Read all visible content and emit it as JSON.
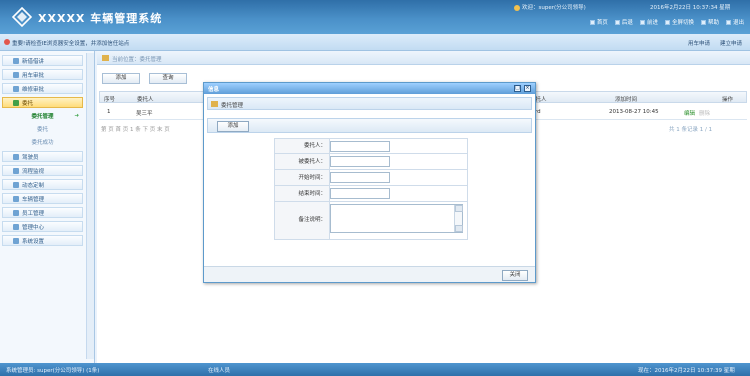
{
  "header": {
    "brand": "XXXXX  车辆管理系统",
    "user": "欢迎：super(分公司领导)",
    "datetime": "2016年2月22日  10:37:34 星期",
    "nav": [
      "首页",
      "后退",
      "前进",
      "全屏切换",
      "帮助",
      "退出"
    ]
  },
  "notice": {
    "text": "重要!请检查IE浏览器安全设置，并添加信任站点",
    "links": [
      "用车申请",
      "建立申请"
    ]
  },
  "sidebar": {
    "items": [
      {
        "label": "新借借讲",
        "icon": "document-icon"
      },
      {
        "label": "用车审批",
        "icon": "car-icon"
      },
      {
        "label": "维修审批",
        "icon": "wrench-icon"
      },
      {
        "label": "委托",
        "icon": "check-icon"
      },
      {
        "label": "驾驶员",
        "icon": "person-icon"
      },
      {
        "label": "流程监视",
        "icon": "chart-icon"
      },
      {
        "label": "动态定制",
        "icon": "grid-icon"
      },
      {
        "label": "车辆管理",
        "icon": "car-icon"
      },
      {
        "label": "员工管理",
        "icon": "people-icon"
      },
      {
        "label": "管理中心",
        "icon": "globe-icon"
      },
      {
        "label": "系统设置",
        "icon": "gear-icon"
      }
    ],
    "sub": [
      "委托管理",
      "委托",
      "委托成功"
    ]
  },
  "main": {
    "crumb": "当前位置：委托管理",
    "buttons": [
      "添加",
      "查询"
    ],
    "columns": [
      "序号",
      "委托人",
      "受托人",
      "开始时间",
      "添加时间",
      "操作"
    ],
    "rows": [
      {
        "no": "1",
        "name": "吴三平",
        "trustee": "rd",
        "added": "2013-08-27 10:45",
        "edit": "编辑",
        "delete": "删除"
      }
    ],
    "pager": "第 页 首 页 1 条 下 页 末 页",
    "pager_right": "共 1 条记录    1 / 1"
  },
  "dialog": {
    "title": "信息",
    "crumb": "委托管理",
    "add_label": "添加",
    "fields": [
      {
        "label": "委托人：",
        "value": ""
      },
      {
        "label": "被委托人：",
        "value": ""
      },
      {
        "label": "开始时间：",
        "value": ""
      },
      {
        "label": "结束时间：",
        "value": ""
      }
    ],
    "remark_label": "备注说明：",
    "close_label": "关闭"
  },
  "footer": {
    "left": "系统管理员: super(分公司领导) (1条)",
    "mid": "在线人员",
    "right": "现在：2016年2月22日 10:37:39 星期"
  }
}
